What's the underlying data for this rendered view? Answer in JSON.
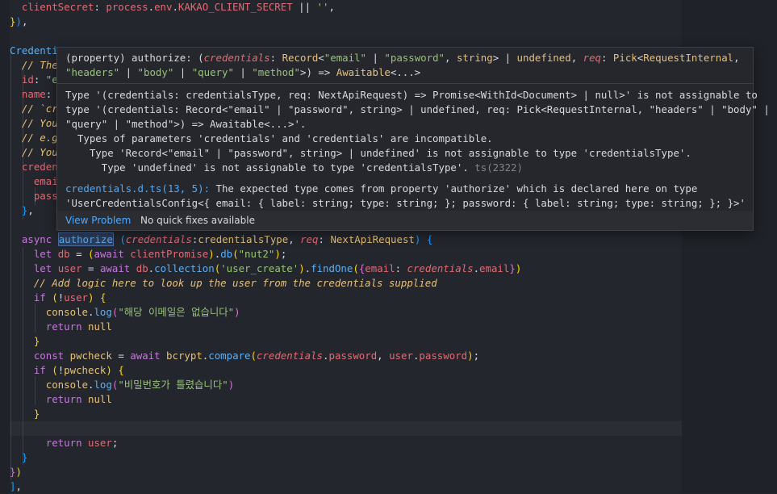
{
  "editor": {
    "lines": [
      "  clientSecret: process.env.KAKAO_CLIENT_SECRET || '',",
      "}),",
      "Credenti",
      "  // The",
      "  id: \"e",
      "  name: ",
      "  // `cr",
      "  // You",
      "  // e.g",
      "  // You",
      "  creden",
      "    emai",
      "    pass",
      "  },",
      "  async authorize (credentials:credentialsType, req: NextApiRequest) {",
      "    let db = (await clientPromise).db(\"nut2\");",
      "    let user = await db.collection('user_create').findOne({email: credentials.email})",
      "    // Add logic here to look up the user from the credentials supplied",
      "    if (!user) {",
      "      console.log(\"해당 이메일은 없습니다\")",
      "      return null",
      "    }",
      "    const pwcheck = await bcrypt.compare(credentials.password, user.password);",
      "    if (!pwcheck) {",
      "      console.log(\"비밀번호가 틀렸습니다\")",
      "      return null",
      "    }",
      "      return user;",
      "  }",
      "})",
      "],"
    ]
  },
  "hover": {
    "signature_line1": "(property) authorize: (credentials: Record<\"email\" | \"password\", string> | undefined, req: Pick<RequestInternal,",
    "signature_line2": "\"headers\" | \"body\" | \"query\" | \"method\">) => Awaitable<...>",
    "error_lines": [
      "Type '(credentials: credentialsType, req: NextApiRequest) => Promise<WithId<Document> | null>' is not assignable to",
      "type '(credentials: Record<\"email\" | \"password\", string> | undefined, req: Pick<RequestInternal, \"headers\" | \"body\" |",
      "\"query\" | \"method\">) => Awaitable<...>'.",
      "  Types of parameters 'credentials' and 'credentials' are incompatible.",
      "    Type 'Record<\"email\" | \"password\", string> | undefined' is not assignable to type 'credentialsType'.",
      "      Type 'undefined' is not assignable to type 'credentialsType'."
    ],
    "error_code": "ts(2322)",
    "related_link": "credentials.d.ts(13, 5):",
    "related_text_line1": " The expected type comes from property 'authorize' which is declared here on type",
    "related_text_line2": "'UserCredentialsConfig<{ email: { label: string; type: string; }; password: { label: string; type: string; }; }>'",
    "view_problem": "View Problem",
    "no_fixes": "No quick fixes available"
  }
}
